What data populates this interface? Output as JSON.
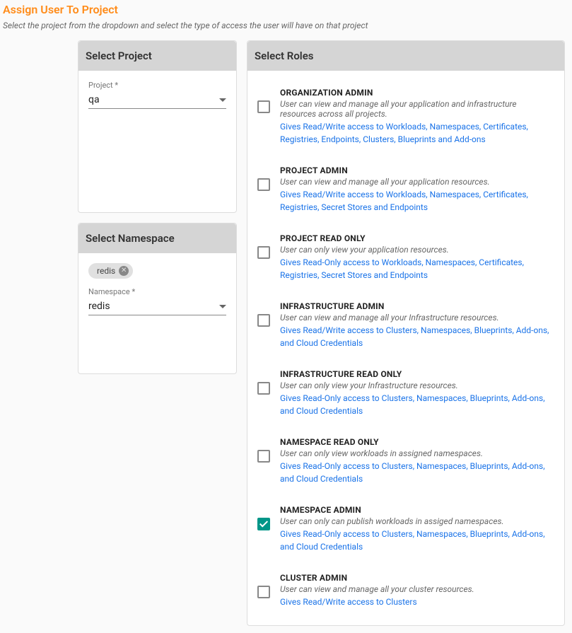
{
  "page": {
    "title": "Assign User To Project",
    "subtitle": "Select the project from the dropdown and select the type of access the user will have on that project"
  },
  "project_panel": {
    "header": "Select Project",
    "field_label": "Project *",
    "value": "qa"
  },
  "namespace_panel": {
    "header": "Select Namespace",
    "chip": "redis",
    "field_label": "Namespace *",
    "value": "redis"
  },
  "roles_panel": {
    "header": "Select Roles",
    "roles": [
      {
        "name": "ORGANIZATION ADMIN",
        "desc": "User can view and manage all your application and infrastructure resources across all projects.",
        "perm": "Gives Read/Write access to Workloads, Namespaces, Certificates, Registries, Endpoints, Clusters, Blueprints and Add-ons",
        "checked": false
      },
      {
        "name": "PROJECT ADMIN",
        "desc": "User can view and manage all your application resources.",
        "perm": "Gives Read/Write access to Workloads, Namespaces, Certificates, Registries, Secret Stores and Endpoints",
        "checked": false
      },
      {
        "name": "PROJECT READ ONLY",
        "desc": "User can only view your application resources.",
        "perm": "Gives Read-Only access to Workloads, Namespaces, Certificates, Registries, Secret Stores and Endpoints",
        "checked": false
      },
      {
        "name": "INFRASTRUCTURE ADMIN",
        "desc": "User can view and manage all your Infrastructure resources.",
        "perm": "Gives Read/Write access to Clusters, Namespaces, Blueprints, Add-ons, and Cloud Credentials",
        "checked": false
      },
      {
        "name": "INFRASTRUCTURE READ ONLY",
        "desc": "User can only view your Infrastructure resources.",
        "perm": "Gives Read-Only access to Clusters, Namespaces, Blueprints, Add-ons, and Cloud Credentials",
        "checked": false
      },
      {
        "name": "NAMESPACE READ ONLY",
        "desc": "User can only view workloads in assigned namespaces.",
        "perm": "Gives Read-Only access to Clusters, Namespaces, Blueprints, Add-ons, and Cloud Credentials",
        "checked": false
      },
      {
        "name": "NAMESPACE ADMIN",
        "desc": "User can only can publish workloads in assiged namespaces.",
        "perm": "Gives Read-Only access to Clusters, Namespaces, Blueprints, Add-ons, and Cloud Credentials",
        "checked": true
      },
      {
        "name": "CLUSTER ADMIN",
        "desc": "User can view and manage all your cluster resources.",
        "perm": "Gives Read/Write access to Clusters",
        "checked": false
      }
    ]
  }
}
